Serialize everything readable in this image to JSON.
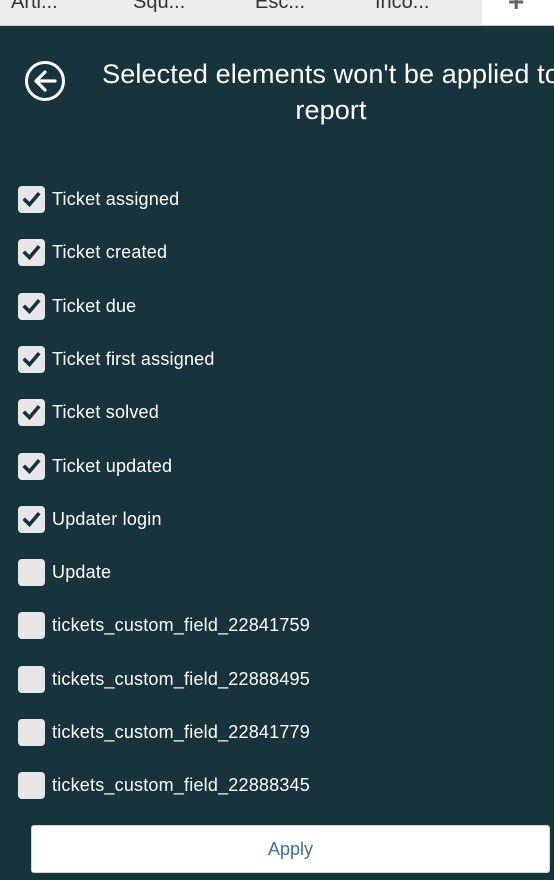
{
  "tabs": [
    "Arti...",
    "Squ...",
    "Esc...",
    "Inco..."
  ],
  "add_tab_icon": "plus-icon",
  "header": {
    "title": "Selected elements won't be applied to report",
    "back_icon": "back-arrow-circle-icon"
  },
  "items": [
    {
      "label": "Ticket assigned",
      "checked": true
    },
    {
      "label": "Ticket created",
      "checked": true
    },
    {
      "label": "Ticket due",
      "checked": true
    },
    {
      "label": "Ticket first assigned",
      "checked": true
    },
    {
      "label": "Ticket solved",
      "checked": true
    },
    {
      "label": "Ticket updated",
      "checked": true
    },
    {
      "label": "Updater login",
      "checked": true
    },
    {
      "label": "Update",
      "checked": false
    },
    {
      "label": "tickets_custom_field_22841759",
      "checked": false
    },
    {
      "label": "tickets_custom_field_22888495",
      "checked": false
    },
    {
      "label": "tickets_custom_field_22841779",
      "checked": false
    },
    {
      "label": "tickets_custom_field_22888345",
      "checked": false
    }
  ],
  "apply_label": "Apply",
  "colors": {
    "background": "#17333b",
    "checkbox": "#e7e7ea",
    "checkmark": "#17333b",
    "apply_text": "#3c6fa9"
  }
}
